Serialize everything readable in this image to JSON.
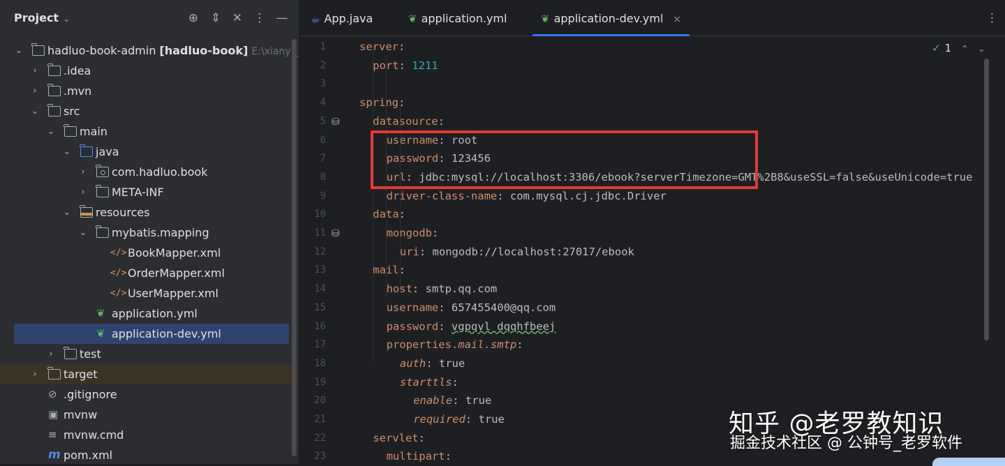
{
  "project_panel": {
    "title": "Project",
    "title_chevron": "⌄",
    "header_icons": [
      "crosshair-icon",
      "expand-collapse-icon",
      "collapse-all-icon",
      "more-icon",
      "minimize-icon"
    ],
    "tree": [
      {
        "label": "hadluo-book-admin",
        "bold": "[hadluo-book]",
        "path": "E:\\xianyu_ga",
        "icon": "folder",
        "arrow": "⌄",
        "depth": 0
      },
      {
        "label": ".idea",
        "icon": "folder",
        "arrow": "›",
        "depth": 1
      },
      {
        "label": ".mvn",
        "icon": "folder",
        "arrow": "›",
        "depth": 1
      },
      {
        "label": "src",
        "icon": "folder",
        "arrow": "⌄",
        "depth": 1
      },
      {
        "label": "main",
        "icon": "folder",
        "arrow": "⌄",
        "depth": 2
      },
      {
        "label": "java",
        "icon": "folder-blue",
        "arrow": "⌄",
        "depth": 3
      },
      {
        "label": "com.hadluo.book",
        "icon": "package",
        "arrow": "›",
        "depth": 4
      },
      {
        "label": "META-INF",
        "icon": "folder",
        "arrow": "›",
        "depth": 4
      },
      {
        "label": "resources",
        "icon": "folder-res",
        "arrow": "⌄",
        "depth": 3
      },
      {
        "label": "mybatis.mapping",
        "icon": "folder",
        "arrow": "⌄",
        "depth": 4
      },
      {
        "label": "BookMapper.xml",
        "icon": "xml",
        "arrow": "",
        "depth": 5
      },
      {
        "label": "OrderMapper.xml",
        "icon": "xml",
        "arrow": "",
        "depth": 5
      },
      {
        "label": "UserMapper.xml",
        "icon": "xml",
        "arrow": "",
        "depth": 5
      },
      {
        "label": "application.yml",
        "icon": "leaf",
        "arrow": "",
        "depth": 4
      },
      {
        "label": "application-dev.yml",
        "icon": "leaf",
        "arrow": "",
        "depth": 4,
        "selected": true
      },
      {
        "label": "test",
        "icon": "folder",
        "arrow": "›",
        "depth": 2
      },
      {
        "label": "target",
        "icon": "folder",
        "arrow": "›",
        "depth": 1,
        "excluded": true
      },
      {
        "label": ".gitignore",
        "icon": "gitignore",
        "arrow": "",
        "depth": 1
      },
      {
        "label": "mvnw",
        "icon": "terminal",
        "arrow": "",
        "depth": 1
      },
      {
        "label": "mvnw.cmd",
        "icon": "text",
        "arrow": "",
        "depth": 1
      },
      {
        "label": "pom.xml",
        "icon": "maven",
        "arrow": "",
        "depth": 1
      }
    ]
  },
  "tabs": [
    {
      "label": "App.java",
      "icon": "java-icon",
      "active": false
    },
    {
      "label": "application.yml",
      "icon": "spring-leaf-icon",
      "active": false
    },
    {
      "label": "application-dev.yml",
      "icon": "spring-leaf-icon",
      "active": true,
      "close": "×"
    }
  ],
  "tabs_more": "⋮",
  "inspection": {
    "check": "✓",
    "count": "1",
    "up": "⌃",
    "down": "⌄"
  },
  "editor": {
    "lines": [
      {
        "n": "1",
        "indent": 0,
        "tokens": [
          {
            "t": "server",
            "c": "k"
          },
          {
            "t": ":",
            "c": "v"
          }
        ]
      },
      {
        "n": "2",
        "indent": 1,
        "tokens": [
          {
            "t": "port",
            "c": "k"
          },
          {
            "t": ": ",
            "c": "v"
          },
          {
            "t": "1211",
            "c": "n"
          }
        ]
      },
      {
        "n": "3",
        "indent": 0,
        "tokens": []
      },
      {
        "n": "4",
        "indent": 0,
        "tokens": [
          {
            "t": "spring",
            "c": "k"
          },
          {
            "t": ":",
            "c": "v"
          }
        ]
      },
      {
        "n": "5",
        "indent": 1,
        "tokens": [
          {
            "t": "datasource",
            "c": "k"
          },
          {
            "t": ":",
            "c": "v"
          }
        ],
        "db_icon": true
      },
      {
        "n": "6",
        "indent": 2,
        "tokens": [
          {
            "t": "username",
            "c": "k"
          },
          {
            "t": ": root",
            "c": "v"
          }
        ]
      },
      {
        "n": "7",
        "indent": 2,
        "tokens": [
          {
            "t": "password",
            "c": "k"
          },
          {
            "t": ": 123456",
            "c": "v"
          }
        ]
      },
      {
        "n": "8",
        "indent": 2,
        "tokens": [
          {
            "t": "url",
            "c": "k"
          },
          {
            "t": ": jdbc:mysql://localhost:3306/ebook?serverTimezone=GMT%2B8&useSSL=false&useUnicode=true",
            "c": "v"
          }
        ]
      },
      {
        "n": "9",
        "indent": 2,
        "tokens": [
          {
            "t": "driver-class-name",
            "c": "k"
          },
          {
            "t": ": com.mysql.cj.jdbc.Driver",
            "c": "v"
          }
        ]
      },
      {
        "n": "10",
        "indent": 1,
        "tokens": [
          {
            "t": "data",
            "c": "k"
          },
          {
            "t": ":",
            "c": "v"
          }
        ]
      },
      {
        "n": "11",
        "indent": 2,
        "tokens": [
          {
            "t": "mongodb",
            "c": "k"
          },
          {
            "t": ":",
            "c": "v"
          }
        ],
        "db_icon": true
      },
      {
        "n": "12",
        "indent": 3,
        "tokens": [
          {
            "t": "uri",
            "c": "k"
          },
          {
            "t": ": mongodb://localhost:27017/ebook",
            "c": "v"
          }
        ]
      },
      {
        "n": "13",
        "indent": 1,
        "tokens": [
          {
            "t": "mail",
            "c": "k"
          },
          {
            "t": ":",
            "c": "v"
          }
        ]
      },
      {
        "n": "14",
        "indent": 2,
        "tokens": [
          {
            "t": "host",
            "c": "k"
          },
          {
            "t": ": smtp.qq.com",
            "c": "v"
          }
        ]
      },
      {
        "n": "15",
        "indent": 2,
        "tokens": [
          {
            "t": "username",
            "c": "k"
          },
          {
            "t": ": 657455400@qq.com",
            "c": "v"
          }
        ]
      },
      {
        "n": "16",
        "indent": 2,
        "tokens": [
          {
            "t": "password",
            "c": "k"
          },
          {
            "t": ": ",
            "c": "v"
          },
          {
            "t": "vgpqvl dqqhfbeej",
            "c": "v squig"
          }
        ]
      },
      {
        "n": "17",
        "indent": 2,
        "tokens": [
          {
            "t": "properties.",
            "c": "k"
          },
          {
            "t": "mail.smtp",
            "c": "k i"
          },
          {
            "t": ":",
            "c": "v"
          }
        ]
      },
      {
        "n": "18",
        "indent": 3,
        "tokens": [
          {
            "t": "auth",
            "c": "k i"
          },
          {
            "t": ": true",
            "c": "v"
          }
        ]
      },
      {
        "n": "19",
        "indent": 3,
        "tokens": [
          {
            "t": "starttls",
            "c": "k i"
          },
          {
            "t": ":",
            "c": "v"
          }
        ]
      },
      {
        "n": "20",
        "indent": 4,
        "tokens": [
          {
            "t": "enable",
            "c": "k i"
          },
          {
            "t": ": true",
            "c": "v"
          }
        ]
      },
      {
        "n": "21",
        "indent": 4,
        "tokens": [
          {
            "t": "required",
            "c": "k i"
          },
          {
            "t": ": true",
            "c": "v"
          }
        ]
      },
      {
        "n": "22",
        "indent": 1,
        "tokens": [
          {
            "t": "servlet",
            "c": "k"
          },
          {
            "t": ":",
            "c": "v"
          }
        ]
      },
      {
        "n": "23",
        "indent": 2,
        "tokens": [
          {
            "t": "multipart",
            "c": "k"
          },
          {
            "t": ":",
            "c": "v"
          }
        ]
      }
    ]
  },
  "watermark": {
    "line1": "知乎 @老罗教知识",
    "line2": "掘金技术社区 @ 公钟号_老罗软件"
  },
  "colors": {
    "highlight_box": "#e53935",
    "selection": "#2e436e",
    "accent": "#3574f0"
  }
}
